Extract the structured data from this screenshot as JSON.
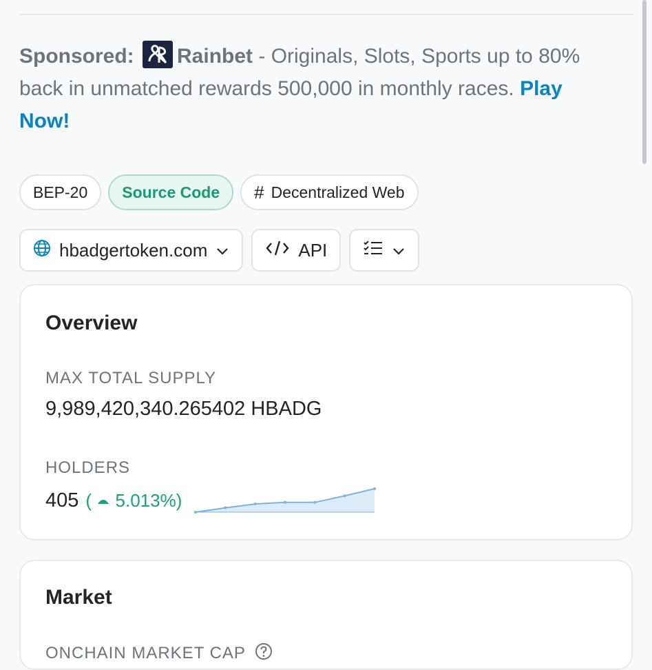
{
  "sponsor": {
    "lead": "Sponsored:",
    "brand": "Rainbet",
    "text": " - Originals, Slots, Sports up to 80% back in unmatched rewards 500,000 in monthly races. ",
    "cta": "Play Now!"
  },
  "chips": {
    "standard": "BEP-20",
    "source_code": "Source Code",
    "tag": "Decentralized Web"
  },
  "toolbar": {
    "website": "hbadgertoken.com",
    "api": "API"
  },
  "overview": {
    "title": "Overview",
    "max_supply_label": "MAX TOTAL SUPPLY",
    "max_supply_value": "9,989,420,340.265402 HBADG",
    "holders_label": "HOLDERS",
    "holders_value": "405",
    "holders_change": "5.013%",
    "holders_change_open": "(",
    "holders_change_close": ")"
  },
  "market": {
    "title": "Market",
    "onchain_cap_label": "ONCHAIN MARKET CAP"
  },
  "chart_data": {
    "type": "area",
    "x": [
      0,
      1,
      2,
      3,
      4,
      5,
      6
    ],
    "series": [
      {
        "values": [
          0,
          8,
          15,
          18,
          18,
          30,
          43
        ]
      }
    ]
  },
  "colors": {
    "accent_link": "#0784c3",
    "positive": "#1aa37a",
    "spark_line": "#7fb2dc",
    "spark_fill": "#dcebf8"
  },
  "icons": {
    "brand": "rainbet-logo-icon",
    "website": "globe-icon",
    "api": "code-icon",
    "menu": "checklist-icon",
    "dropdown": "chevron-down-icon",
    "change": "triangle-up-icon",
    "help": "question-circle-icon"
  }
}
